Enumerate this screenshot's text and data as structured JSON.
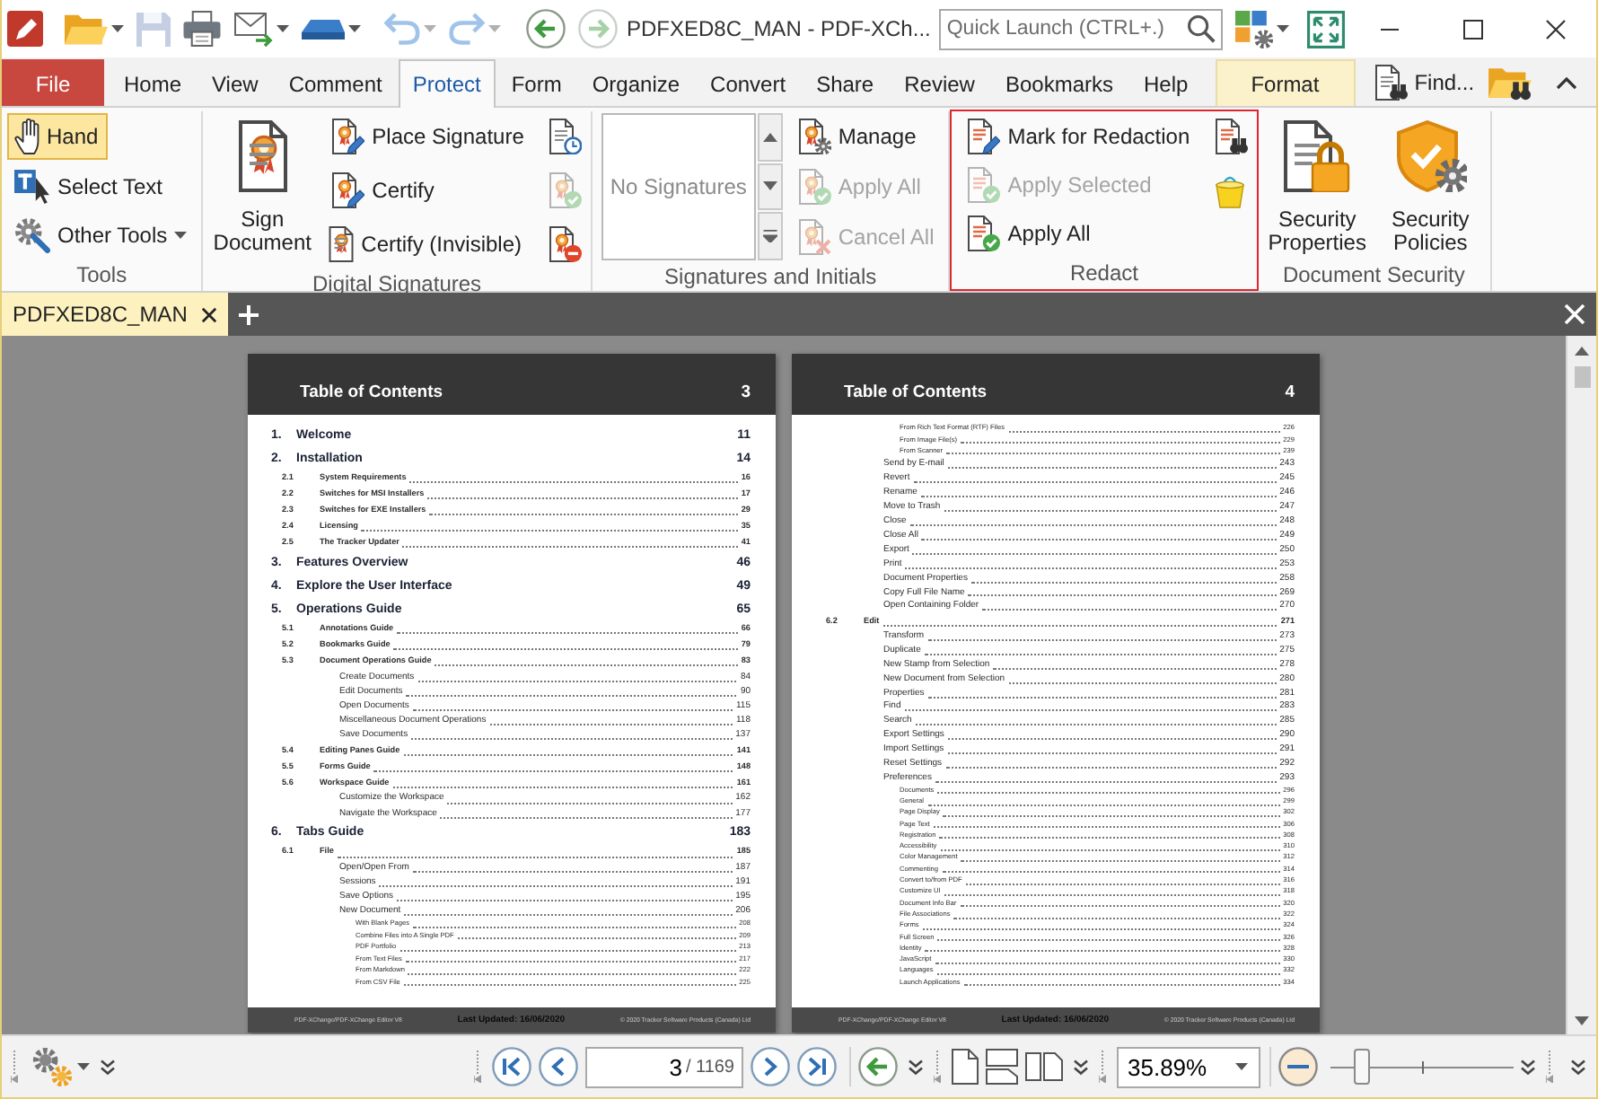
{
  "title_bar": {
    "tools": [
      {
        "kind": "open",
        "disabled": false,
        "dropdown": true
      },
      {
        "kind": "save",
        "disabled": true,
        "dropdown": false
      },
      {
        "kind": "print",
        "disabled": false,
        "dropdown": false
      },
      {
        "kind": "email",
        "disabled": false,
        "dropdown": true
      },
      {
        "kind": "scan",
        "disabled": false,
        "dropdown": true
      },
      {
        "kind": "undo",
        "disabled": true,
        "dropdown": true
      },
      {
        "kind": "redo",
        "disabled": true,
        "dropdown": true
      },
      {
        "kind": "back",
        "disabled": false,
        "dropdown": false
      },
      {
        "kind": "forward",
        "disabled": true,
        "dropdown": false
      }
    ],
    "title": "PDFXED8C_MAN - PDF-XCh...",
    "quick_launch": {
      "placeholder": "Quick Launch (CTRL+.)"
    }
  },
  "menu_tabs": [
    {
      "label": "File",
      "kind": "backstage",
      "selected": false
    },
    {
      "label": "Home",
      "kind": "tab",
      "selected": false
    },
    {
      "label": "View",
      "kind": "tab",
      "selected": false
    },
    {
      "label": "Comment",
      "kind": "tab",
      "selected": false
    },
    {
      "label": "Protect",
      "kind": "tab",
      "selected": true
    },
    {
      "label": "Form",
      "kind": "tab",
      "selected": false
    },
    {
      "label": "Organize",
      "kind": "tab",
      "selected": false
    },
    {
      "label": "Convert",
      "kind": "tab",
      "selected": false
    },
    {
      "label": "Share",
      "kind": "tab",
      "selected": false
    },
    {
      "label": "Review",
      "kind": "tab",
      "selected": false
    },
    {
      "label": "Bookmarks",
      "kind": "tab",
      "selected": false
    },
    {
      "label": "Help",
      "kind": "tab",
      "selected": false
    },
    {
      "label": "Format",
      "kind": "contextual",
      "selected": false
    }
  ],
  "find": {
    "label": "Find..."
  },
  "ribbon": {
    "groups": [
      {
        "label": "Tools",
        "highlighted": false,
        "columns": [
          {
            "kind": "small",
            "buttons": [
              {
                "kind": "hand",
                "label": "Hand",
                "selected": true,
                "disabled": false,
                "dropdown": false
              },
              {
                "kind": "textselect",
                "label": "Select Text",
                "selected": false,
                "disabled": false,
                "dropdown": false
              },
              {
                "kind": "othertools",
                "label": "Other Tools",
                "selected": false,
                "disabled": false,
                "dropdown": true
              }
            ]
          }
        ]
      },
      {
        "label": "Digital Signatures",
        "highlighted": false,
        "columns": [
          {
            "kind": "large",
            "buttons": [
              {
                "kind": "sign",
                "label": "Sign Document",
                "disabled": false
              }
            ]
          },
          {
            "kind": "small",
            "buttons": [
              {
                "kind": "place",
                "label": "Place Signature",
                "disabled": false
              },
              {
                "kind": "certify",
                "label": "Certify",
                "disabled": false
              },
              {
                "kind": "certifyhidden",
                "label": "Certify (Invisible)",
                "disabled": false
              }
            ]
          },
          {
            "kind": "icons",
            "buttons": [
              {
                "kind": "timestamp",
                "disabled": false
              },
              {
                "kind": "validate",
                "disabled": true
              },
              {
                "kind": "clear",
                "disabled": false
              }
            ]
          }
        ]
      },
      {
        "label": "Signatures and Initials",
        "highlighted": false,
        "columns": [
          {
            "kind": "listbox",
            "empty_text": "No Signatures"
          },
          {
            "kind": "small",
            "buttons": [
              {
                "kind": "manage",
                "label": "Manage",
                "disabled": false
              },
              {
                "kind": "applysig",
                "label": "Apply All",
                "disabled": true
              },
              {
                "kind": "cancel",
                "label": "Cancel All",
                "disabled": true
              }
            ]
          }
        ]
      },
      {
        "label": "Redact",
        "highlighted": true,
        "columns": [
          {
            "kind": "small",
            "buttons": [
              {
                "kind": "mark",
                "label": "Mark for Redaction",
                "disabled": false
              },
              {
                "kind": "applyselected",
                "label": "Apply Selected",
                "disabled": true
              },
              {
                "kind": "applyredact",
                "label": "Apply All",
                "disabled": false
              }
            ]
          },
          {
            "kind": "icons",
            "buttons": [
              {
                "kind": "searchredact",
                "disabled": false
              },
              {
                "kind": "bucket",
                "disabled": false
              }
            ]
          }
        ]
      },
      {
        "label": "Document Security",
        "highlighted": false,
        "columns": [
          {
            "kind": "large",
            "buttons": [
              {
                "kind": "lock",
                "label": "Security Properties",
                "disabled": false
              }
            ]
          },
          {
            "kind": "large",
            "buttons": [
              {
                "kind": "shield",
                "label": "Security Policies",
                "disabled": false
              }
            ]
          }
        ]
      }
    ]
  },
  "document_tabs": [
    {
      "label": "PDFXED8C_MAN",
      "selected": true
    }
  ],
  "pages": [
    {
      "header": "Table of Contents",
      "number": "3",
      "entries": [
        {
          "number": "1.",
          "title": "Welcome",
          "page": "11"
        },
        {
          "number": "2.",
          "title": "Installation",
          "page": "14",
          "children": [
            {
              "number": "2.1",
              "title": "System Requirements",
              "page": "16"
            },
            {
              "number": "2.2",
              "title": "Switches for MSI Installers",
              "page": "17"
            },
            {
              "number": "2.3",
              "title": "Switches for EXE Installers",
              "page": "29"
            },
            {
              "number": "2.4",
              "title": "Licensing",
              "page": "35"
            },
            {
              "number": "2.5",
              "title": "The Tracker Updater",
              "page": "41"
            }
          ]
        },
        {
          "number": "3.",
          "title": "Features Overview",
          "page": "46"
        },
        {
          "number": "4.",
          "title": "Explore the User Interface",
          "page": "49"
        },
        {
          "number": "5.",
          "title": "Operations Guide",
          "page": "65",
          "children": [
            {
              "number": "5.1",
              "title": "Annotations Guide",
              "page": "66"
            },
            {
              "number": "5.2",
              "title": "Bookmarks Guide",
              "page": "79"
            },
            {
              "number": "5.3",
              "title": "Document Operations Guide",
              "page": "83",
              "children": [
                {
                  "title": "Create Documents",
                  "page": "84"
                },
                {
                  "title": "Edit Documents",
                  "page": "90"
                },
                {
                  "title": "Open Documents",
                  "page": "115"
                },
                {
                  "title": "Miscellaneous Document Operations",
                  "page": "118"
                },
                {
                  "title": "Save Documents",
                  "page": "137"
                }
              ]
            },
            {
              "number": "5.4",
              "title": "Editing Panes Guide",
              "page": "141"
            },
            {
              "number": "5.5",
              "title": "Forms Guide",
              "page": "148"
            },
            {
              "number": "5.6",
              "title": "Workspace Guide",
              "page": "161",
              "children": [
                {
                  "title": "Customize the Workspace",
                  "page": "162"
                },
                {
                  "title": "Navigate the Workspace",
                  "page": "177"
                }
              ]
            }
          ]
        },
        {
          "number": "6.",
          "title": "Tabs Guide",
          "page": "183",
          "children": [
            {
              "number": "6.1",
              "title": "File",
              "page": "185",
              "children": [
                {
                  "title": "Open/Open From",
                  "page": "187"
                },
                {
                  "title": "Sessions",
                  "page": "191"
                },
                {
                  "title": "Save Options",
                  "page": "195"
                },
                {
                  "title": "New Document",
                  "page": "206",
                  "children": [
                    {
                      "title": "With Blank Pages",
                      "page": "208"
                    },
                    {
                      "title": "Combine Files into A Single PDF",
                      "page": "209"
                    },
                    {
                      "title": "PDF Portfolio",
                      "page": "213"
                    },
                    {
                      "title": "From Text Files",
                      "page": "217"
                    },
                    {
                      "title": "From Markdown",
                      "page": "222"
                    },
                    {
                      "title": "From CSV File",
                      "page": "225"
                    }
                  ]
                }
              ]
            }
          ]
        }
      ],
      "footer": {
        "left": "PDF-XChange/PDF-XChange Editor V8",
        "center": "Last Updated: 16/06/2020",
        "right": "© 2020 Tracker Software Products (Canada) Ltd"
      }
    },
    {
      "header": "Table of Contents",
      "number": "4",
      "entries": [
        {
          "children": [
            {
              "children": [
                {
                  "children": [
                    {
                      "title": "From Rich Text Format (RTF) Files",
                      "page": "226"
                    },
                    {
                      "title": "From Image File(s)",
                      "page": "229"
                    },
                    {
                      "title": "From Scanner",
                      "page": "239"
                    }
                  ]
                },
                {
                  "title": "Send by E-mail",
                  "page": "243"
                },
                {
                  "title": "Revert",
                  "page": "245"
                },
                {
                  "title": "Rename",
                  "page": "246"
                },
                {
                  "title": "Move to Trash",
                  "page": "247"
                },
                {
                  "title": "Close",
                  "page": "248"
                },
                {
                  "title": "Close All",
                  "page": "249"
                },
                {
                  "title": "Export",
                  "page": "250"
                },
                {
                  "title": "Print",
                  "page": "253"
                },
                {
                  "title": "Document Properties",
                  "page": "258"
                },
                {
                  "title": "Copy Full File Name",
                  "page": "269"
                },
                {
                  "title": "Open Containing Folder",
                  "page": "270"
                }
              ]
            },
            {
              "number": "6.2",
              "title": "Edit",
              "page": "271",
              "children": [
                {
                  "title": "Transform",
                  "page": "273"
                },
                {
                  "title": "Duplicate",
                  "page": "275"
                },
                {
                  "title": "New Stamp from Selection",
                  "page": "278"
                },
                {
                  "title": "New Document from Selection",
                  "page": "280"
                },
                {
                  "title": "Properties",
                  "page": "281"
                },
                {
                  "title": "Find",
                  "page": "283"
                },
                {
                  "title": "Search",
                  "page": "285"
                },
                {
                  "title": "Export Settings",
                  "page": "290"
                },
                {
                  "title": "Import Settings",
                  "page": "291"
                },
                {
                  "title": "Reset Settings",
                  "page": "292"
                },
                {
                  "title": "Preferences",
                  "page": "293",
                  "children": [
                    {
                      "title": "Documents",
                      "page": "296"
                    },
                    {
                      "title": "General",
                      "page": "299"
                    },
                    {
                      "title": "Page Display",
                      "page": "302"
                    },
                    {
                      "title": "Page Text",
                      "page": "306"
                    },
                    {
                      "title": "Registration",
                      "page": "308"
                    },
                    {
                      "title": "Accessibility",
                      "page": "310"
                    },
                    {
                      "title": "Color Management",
                      "page": "312"
                    },
                    {
                      "title": "Commenting",
                      "page": "314"
                    },
                    {
                      "title": "Convert to/from PDF",
                      "page": "316"
                    },
                    {
                      "title": "Customize UI",
                      "page": "318"
                    },
                    {
                      "title": "Document Info Bar",
                      "page": "320"
                    },
                    {
                      "title": "File Associations",
                      "page": "322"
                    },
                    {
                      "title": "Forms",
                      "page": "324"
                    },
                    {
                      "title": "Full Screen",
                      "page": "326"
                    },
                    {
                      "title": "Identity",
                      "page": "328"
                    },
                    {
                      "title": "JavaScript",
                      "page": "330"
                    },
                    {
                      "title": "Languages",
                      "page": "332"
                    },
                    {
                      "title": "Launch Applications",
                      "page": "334"
                    }
                  ]
                }
              ]
            }
          ]
        }
      ],
      "footer": {
        "left": "PDF-XChange/PDF-XChange Editor V8",
        "center": "Last Updated: 16/06/2020",
        "right": "© 2020 Tracker Software Products (Canada) Ltd"
      }
    }
  ],
  "status_bar": {
    "page_field": {
      "value": "3"
    },
    "page_total": "/ 1169",
    "zoom_field": {
      "value": "35.89%"
    },
    "zoom_slider": {
      "level": 0.17
    }
  }
}
